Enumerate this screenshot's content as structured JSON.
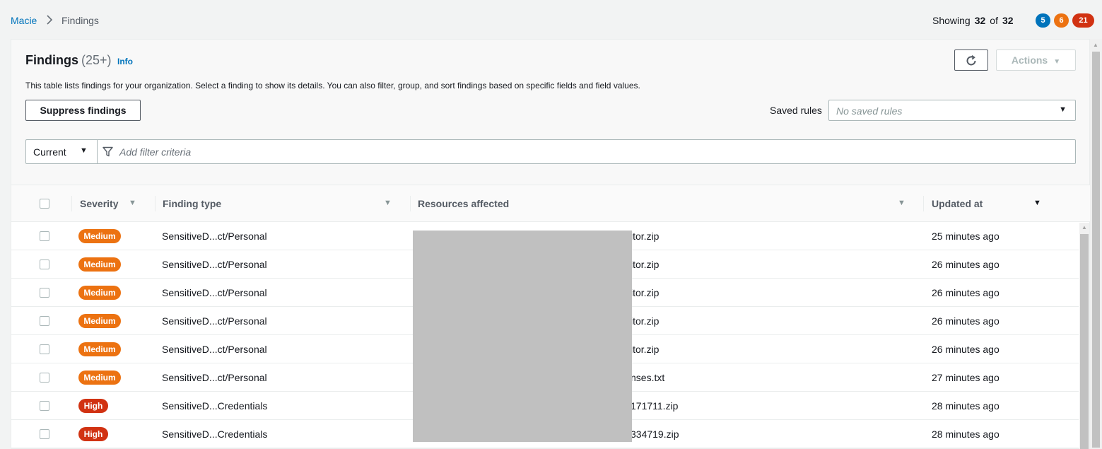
{
  "breadcrumb": {
    "root": "Macie",
    "separator": ">",
    "current": "Findings"
  },
  "summary": {
    "showing_label": "Showing",
    "shown": "32",
    "of_label": "of",
    "total": "32",
    "low_count": "5",
    "medium_count": "6",
    "high_count": "21"
  },
  "header": {
    "title": "Findings",
    "count": "(25+)",
    "info": "Info",
    "description": "This table lists findings for your organization. Select a finding to show its details. You can also filter, group, and sort findings based on specific fields and field values.",
    "refresh_icon": "refresh-icon",
    "actions_label": "Actions",
    "suppress_label": "Suppress findings",
    "saved_rules_label": "Saved rules",
    "saved_rules_placeholder": "No saved rules"
  },
  "filter": {
    "scope": "Current",
    "placeholder": "Add filter criteria",
    "icon": "filter-icon"
  },
  "columns": [
    "Severity",
    "Finding type",
    "Resources affected",
    "Updated at"
  ],
  "rows": [
    {
      "severity": "Medium",
      "type": "SensitiveD...ct/Personal",
      "resource": "itor.zip",
      "updated": "25 minutes ago"
    },
    {
      "severity": "Medium",
      "type": "SensitiveD...ct/Personal",
      "resource": "itor.zip",
      "updated": "26 minutes ago"
    },
    {
      "severity": "Medium",
      "type": "SensitiveD...ct/Personal",
      "resource": "itor.zip",
      "updated": "26 minutes ago"
    },
    {
      "severity": "Medium",
      "type": "SensitiveD...ct/Personal",
      "resource": "itor.zip",
      "updated": "26 minutes ago"
    },
    {
      "severity": "Medium",
      "type": "SensitiveD...ct/Personal",
      "resource": "itor.zip",
      "updated": "26 minutes ago"
    },
    {
      "severity": "Medium",
      "type": "SensitiveD...ct/Personal",
      "resource": "nses.txt",
      "updated": "27 minutes ago"
    },
    {
      "severity": "High",
      "type": "SensitiveD...Credentials",
      "resource": "171711.zip",
      "updated": "28 minutes ago"
    },
    {
      "severity": "High",
      "type": "SensitiveD...Credentials",
      "resource": "334719.zip",
      "updated": "28 minutes ago"
    }
  ],
  "colors": {
    "medium": "#ec7211",
    "high": "#d13212",
    "low": "#0073bb",
    "link": "#0073bb"
  }
}
